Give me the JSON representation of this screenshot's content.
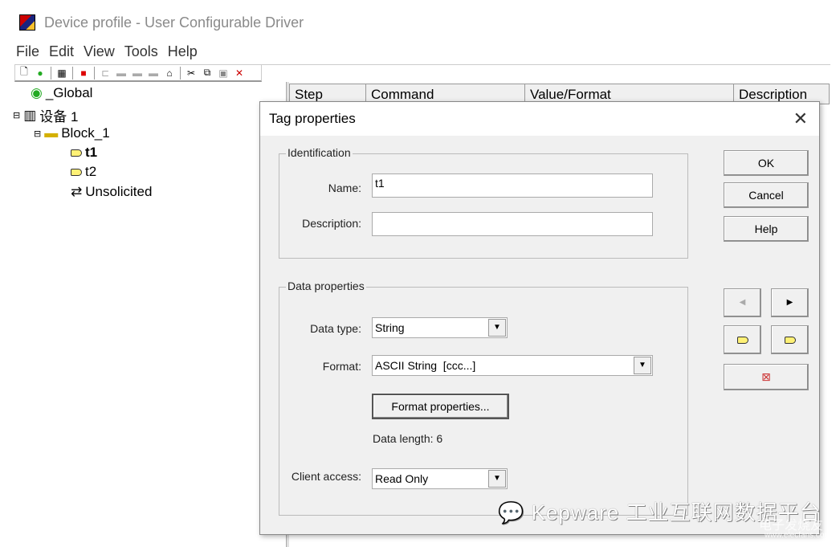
{
  "window": {
    "title": "Device profile - User Configurable Driver"
  },
  "menu": [
    "File",
    "Edit",
    "View",
    "Tools",
    "Help"
  ],
  "toolbar": {
    "icons": [
      "new-icon",
      "globe-icon",
      "device-icon",
      "properties-icon",
      "tree-icon",
      "folder-icon",
      "folder-icon",
      "folder-icon",
      "settings-icon",
      "cut-icon",
      "copy-icon",
      "paste-icon",
      "delete-icon"
    ]
  },
  "tree": {
    "global": "_Global",
    "device": "设备 1",
    "block": "Block_1",
    "tags": [
      "t1",
      "t2"
    ],
    "unsolicited": "Unsolicited"
  },
  "columns": [
    "Step",
    "Command",
    "Value/Format",
    "Description"
  ],
  "dialog": {
    "title": "Tag properties",
    "identification": {
      "label": "Identification",
      "name_label": "Name:",
      "name_value": "t1",
      "description_label": "Description:",
      "description_value": ""
    },
    "data": {
      "label": "Data properties",
      "type_label": "Data type:",
      "type_value": "String",
      "format_label": "Format:",
      "format_value": "ASCII String  [ccc...]",
      "format_button": "Format properties...",
      "length_label": "Data length:",
      "length_value": "6",
      "access_label": "Client access:",
      "access_value": "Read Only"
    },
    "buttons": {
      "ok": "OK",
      "cancel": "Cancel",
      "help": "Help"
    }
  },
  "watermark": {
    "text": "Kepware 工业互联网数据平台",
    "site": "电子发烧友",
    "url": "www.elecfans.com"
  }
}
